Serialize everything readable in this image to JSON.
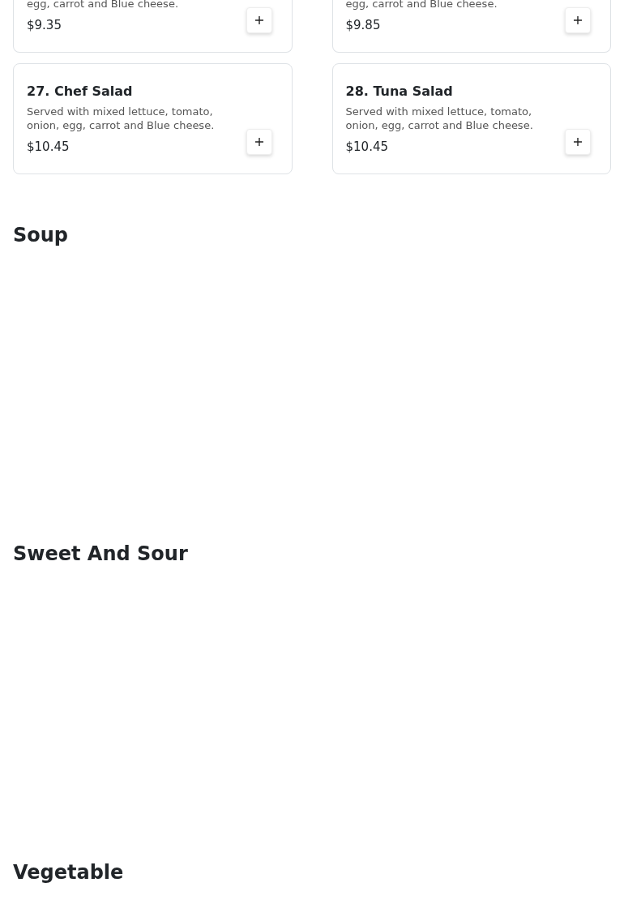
{
  "items": [
    {
      "description": "egg, carrot and Blue cheese.",
      "price": "$9.35"
    },
    {
      "description": "egg, carrot and Blue cheese.",
      "price": "$9.85"
    },
    {
      "name": "27. Chef Salad",
      "description": "Served with mixed lettuce, tomato, onion, egg, carrot and Blue cheese.",
      "price": "$10.45"
    },
    {
      "name": "28. Tuna Salad",
      "description": "Served with mixed lettuce, tomato, onion, egg, carrot and Blue cheese.",
      "price": "$10.45"
    }
  ],
  "sections": [
    {
      "title": "Soup"
    },
    {
      "title": "Sweet And Sour"
    },
    {
      "title": "Vegetable"
    }
  ]
}
